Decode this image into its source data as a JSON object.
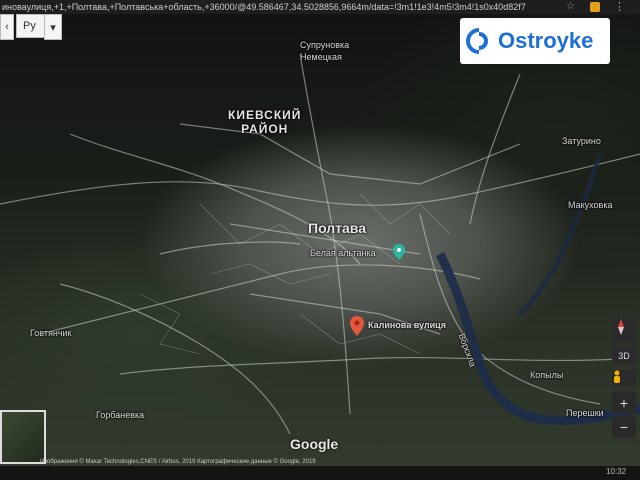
{
  "browser": {
    "url": "иноваулиця,+1,+Полтава,+Полтавська+область,+36000/@49.586467,34.5028856,9664m/data=!3m1!1e3!4m5!3m4!1s0x40d82f7"
  },
  "toolbar": {
    "language": "Ру",
    "dropdown": "▾"
  },
  "brand": {
    "name": "Ostroyke",
    "color": "#1d6fd6"
  },
  "map": {
    "labels": {
      "district_line1": "КИЕВСКИЙ",
      "district_line2": "РАЙОН",
      "city": "Полтава",
      "poi": "Белая альтанка",
      "pin_label": "Калинова вулиця",
      "north_label_1": "Супруновка",
      "north_label_2": "Немецкая",
      "zaturino": "Затурино",
      "makuhovka": "Макуховка",
      "govtyanchik": "Говтянчик",
      "gorbanevka": "Горбаневка",
      "vorskla": "Ворскла",
      "kopyly": "Копылы",
      "pereshki": "Перешки",
      "google": "Google"
    },
    "attribution": "Изображения © Maxar Technologies,CNES / Airbus, 2019 Картографические данные © Google, 2019",
    "controls": {
      "view3d": "3D",
      "zoom_in": "+",
      "zoom_out": "−"
    }
  },
  "status": {
    "time": "10:32"
  }
}
